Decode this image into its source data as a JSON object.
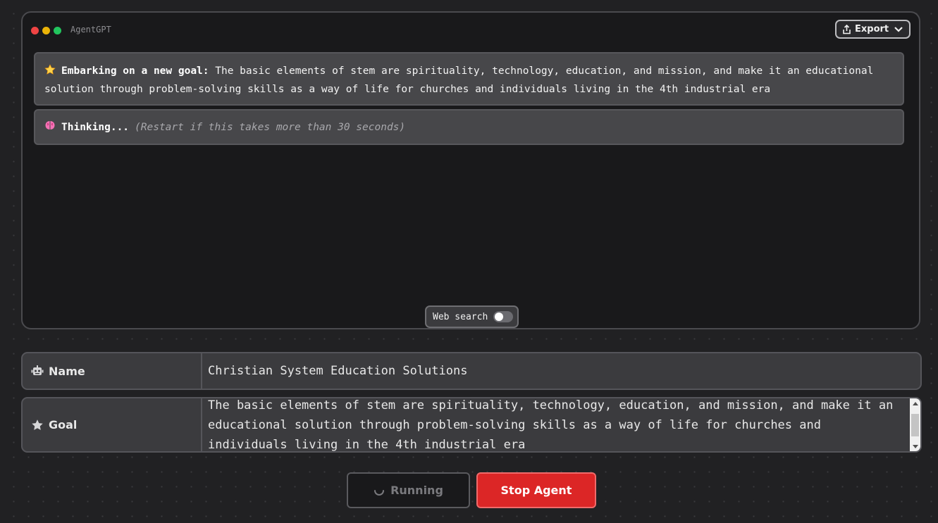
{
  "window": {
    "title": "AgentGPT",
    "traffic_lights": [
      "#ef4444",
      "#eab308",
      "#22c55e"
    ],
    "export_label": "Export"
  },
  "messages": {
    "goal": {
      "icon": "star-icon",
      "prefix": "Embarking on a new goal:",
      "text": "The basic elements of stem are spirituality, technology, education, and mission, and make it an educational solution through problem-solving skills as a way of life for churches and individuals living in the 4th industrial era"
    },
    "thinking": {
      "icon": "brain-icon",
      "label": "Thinking...",
      "hint": "(Restart if this takes more than 30 seconds)"
    }
  },
  "web_search": {
    "label": "Web search",
    "enabled": false
  },
  "form": {
    "name_label": "Name",
    "name_value": "Christian System Education Solutions",
    "goal_label": "Goal",
    "goal_value": "The basic elements of stem are spirituality, technology, education, and mission, and make it an educational solution through problem-solving skills as a way of life for churches and individuals living in the 4th industrial era"
  },
  "actions": {
    "running_label": "Running",
    "stop_label": "Stop Agent"
  },
  "colors": {
    "accent_stop": "#dc2626",
    "background": "#212123",
    "panel": "#19191b"
  }
}
